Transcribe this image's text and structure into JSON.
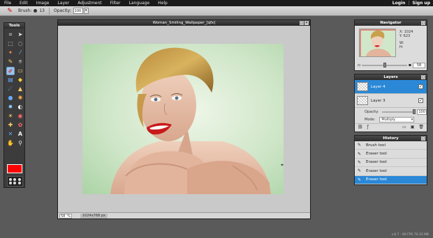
{
  "menubar": {
    "items": [
      "File",
      "Edit",
      "Image",
      "Layer",
      "Adjustment",
      "Filter",
      "Language",
      "Help"
    ],
    "login": "Login",
    "separator": "|",
    "signup": "Sign up"
  },
  "toolbar": {
    "brush_label": "Brush:",
    "brush_size": "13",
    "opacity_label": "Opacity:",
    "opacity_value": "100"
  },
  "tools": {
    "title": "Tools",
    "primary_color": "#ff0000"
  },
  "document": {
    "title": "Woman_Smiling_Wallpaper_[qfx]",
    "zoom": "58",
    "zoom_unit": "%",
    "dimensions": "1024x768 px"
  },
  "navigator": {
    "title": "Navigator",
    "x_label": "X:",
    "x_value": "1024",
    "y_label": "Y:",
    "y_value": "623",
    "w_label": "W:",
    "h_label": "H:",
    "zoom": "58",
    "zoom_level": 0.58
  },
  "layers": {
    "title": "Layers",
    "items": [
      {
        "name": "Layer 4",
        "selected": true
      },
      {
        "name": "Layer 3",
        "selected": false
      }
    ],
    "opacity_label": "Opacity:",
    "opacity_value": "100",
    "mode_label": "Mode:",
    "mode_value": "Multiply"
  },
  "history": {
    "title": "History",
    "items": [
      "Brush tool",
      "Eraser tool",
      "Eraser tool",
      "Eraser tool",
      "Eraser tool"
    ],
    "selected_index": 4
  },
  "footer": {
    "version": "v.6.7 - 60 FPS 70.33 MB"
  },
  "colors": {
    "accent": "#2a88d6",
    "menubar_bg": "#1b1b1b",
    "workspace_bg": "#5a5a5a"
  }
}
